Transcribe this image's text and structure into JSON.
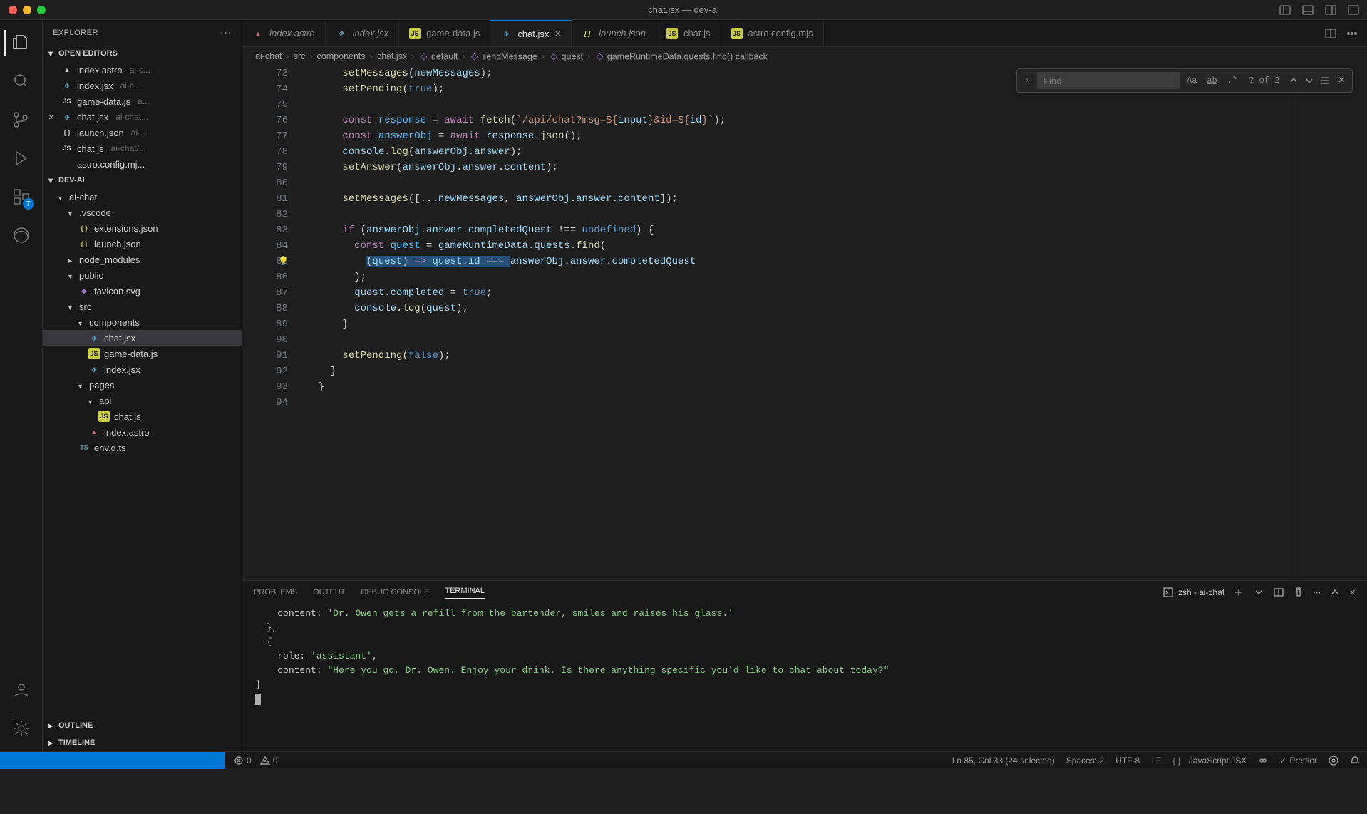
{
  "title": "chat.jsx — dev-ai",
  "explorer": {
    "title": "EXPLORER",
    "openEditorsLabel": "OPEN EDITORS",
    "workspaceLabel": "DEV-AI",
    "outlineLabel": "OUTLINE",
    "timelineLabel": "TIMELINE",
    "openEditors": [
      {
        "name": "index.astro",
        "hint": "ai-c..."
      },
      {
        "name": "index.jsx",
        "hint": "ai-c..."
      },
      {
        "name": "game-data.js",
        "hint": "a..."
      },
      {
        "name": "chat.jsx",
        "hint": "ai-chat...",
        "active": true
      },
      {
        "name": "launch.json",
        "hint": "ai-..."
      },
      {
        "name": "chat.js",
        "hint": "ai-chat/..."
      },
      {
        "name": "astro.config.mj...",
        "hint": ""
      }
    ],
    "tree": [
      {
        "label": "ai-chat",
        "depth": 1,
        "folder": true,
        "open": true
      },
      {
        "label": ".vscode",
        "depth": 2,
        "folder": true,
        "open": true
      },
      {
        "label": "extensions.json",
        "depth": 3,
        "icon": "json"
      },
      {
        "label": "launch.json",
        "depth": 3,
        "icon": "json"
      },
      {
        "label": "node_modules",
        "depth": 2,
        "folder": true
      },
      {
        "label": "public",
        "depth": 2,
        "folder": true,
        "open": true
      },
      {
        "label": "favicon.svg",
        "depth": 3,
        "icon": "svg"
      },
      {
        "label": "src",
        "depth": 2,
        "folder": true,
        "open": true
      },
      {
        "label": "components",
        "depth": 3,
        "folder": true,
        "open": true
      },
      {
        "label": "chat.jsx",
        "depth": 4,
        "icon": "jsx",
        "selected": true
      },
      {
        "label": "game-data.js",
        "depth": 4,
        "icon": "js"
      },
      {
        "label": "index.jsx",
        "depth": 4,
        "icon": "jsx"
      },
      {
        "label": "pages",
        "depth": 3,
        "folder": true,
        "open": true
      },
      {
        "label": "api",
        "depth": 4,
        "folder": true,
        "open": true
      },
      {
        "label": "chat.js",
        "depth": 5,
        "icon": "js"
      },
      {
        "label": "index.astro",
        "depth": 4,
        "icon": "astro"
      },
      {
        "label": "env.d.ts",
        "depth": 3,
        "icon": "ts"
      }
    ]
  },
  "tabs": [
    {
      "label": "index.astro",
      "icon": "astro",
      "italic": true
    },
    {
      "label": "index.jsx",
      "icon": "jsx",
      "italic": true
    },
    {
      "label": "game-data.js",
      "icon": "js"
    },
    {
      "label": "chat.jsx",
      "icon": "jsx",
      "active": true,
      "close": true
    },
    {
      "label": "launch.json",
      "icon": "json",
      "italic": true
    },
    {
      "label": "chat.js",
      "icon": "js"
    },
    {
      "label": "astro.config.mjs",
      "icon": "js"
    }
  ],
  "breadcrumbs": [
    "ai-chat",
    "src",
    "components",
    "chat.jsx",
    "default",
    "sendMessage",
    "quest",
    "gameRuntimeData.quests.find() callback"
  ],
  "find": {
    "placeholder": "Find",
    "count": "? of 2"
  },
  "code": {
    "start": 73,
    "lines": [
      {
        "n": 73,
        "html": "      <span class='c-fn'>setMessages</span>(<span class='c-var'>newMessages</span>);"
      },
      {
        "n": 74,
        "html": "      <span class='c-fn'>setPending</span>(<span class='c-bool'>true</span>);"
      },
      {
        "n": 75,
        "html": ""
      },
      {
        "n": 76,
        "html": "      <span class='c-kw'>const</span> <span class='c-const'>response</span> = <span class='c-kw'>await</span> <span class='c-fn'>fetch</span>(<span class='c-str'>`/api/chat?msg=${</span><span class='c-var'>input</span><span class='c-str'>}&amp;id=${</span><span class='c-var'>id</span><span class='c-str'>}`</span>);"
      },
      {
        "n": 77,
        "html": "      <span class='c-kw'>const</span> <span class='c-const'>answerObj</span> = <span class='c-kw'>await</span> <span class='c-var'>response</span>.<span class='c-fn'>json</span>();"
      },
      {
        "n": 78,
        "html": "      <span class='c-var'>console</span>.<span class='c-fn'>log</span>(<span class='c-var'>answerObj</span>.<span class='c-var'>answer</span>);"
      },
      {
        "n": 79,
        "html": "      <span class='c-fn'>setAnswer</span>(<span class='c-var'>answerObj</span>.<span class='c-var'>answer</span>.<span class='c-var'>content</span>);"
      },
      {
        "n": 80,
        "html": ""
      },
      {
        "n": 81,
        "html": "      <span class='c-fn'>setMessages</span>([...<span class='c-var'>newMessages</span>, <span class='c-var'>answerObj</span>.<span class='c-var'>answer</span>.<span class='c-var'>content</span>]);"
      },
      {
        "n": 82,
        "html": ""
      },
      {
        "n": 83,
        "html": "      <span class='c-kw'>if</span> (<span class='c-var'>answerObj</span>.<span class='c-var'>answer</span>.<span class='c-var'>completedQuest</span> !== <span class='c-bool'>undefined</span>) {"
      },
      {
        "n": 84,
        "html": "        <span class='c-kw'>const</span> <span class='c-const'>quest</span> = <span class='c-var'>gameRuntimeData</span>.<span class='c-var'>quests</span>.<span class='c-fn'>find</span>("
      },
      {
        "n": 85,
        "html": "          <span class='sel'>(<span class='c-var'>quest</span>) <span class='c-kw'>=&gt;</span> <span class='c-var'>quest</span>.<span class='c-var'>id</span> === </span><span class='c-var'>answerObj</span>.<span class='c-var'>answer</span>.<span class='c-var'>completedQuest</span>",
        "bulb": true
      },
      {
        "n": 86,
        "html": "        );"
      },
      {
        "n": 87,
        "html": "        <span class='c-var'>quest</span>.<span class='c-var'>completed</span> = <span class='c-bool'>true</span>;"
      },
      {
        "n": 88,
        "html": "        <span class='c-var'>console</span>.<span class='c-fn'>log</span>(<span class='c-var'>quest</span>);"
      },
      {
        "n": 89,
        "html": "      }"
      },
      {
        "n": 90,
        "html": ""
      },
      {
        "n": 91,
        "html": "      <span class='c-fn'>setPending</span>(<span class='c-bool'>false</span>);"
      },
      {
        "n": 92,
        "html": "    }"
      },
      {
        "n": 93,
        "html": "  }"
      },
      {
        "n": 94,
        "html": ""
      }
    ]
  },
  "panel": {
    "tabs": [
      "PROBLEMS",
      "OUTPUT",
      "DEBUG CONSOLE",
      "TERMINAL"
    ],
    "active": "TERMINAL",
    "shell": "zsh - ai-chat",
    "lines": [
      {
        "html": "    content: <span class='t-str'>'Dr. Owen gets a refill from the bartender, smiles and raises his glass.'</span>"
      },
      {
        "html": "  },"
      },
      {
        "html": "  {"
      },
      {
        "html": "    role: <span class='t-str'>'assistant'</span>,"
      },
      {
        "html": "    content: <span class='t-str'>\"Here you go, Dr. Owen. Enjoy your drink. Is there anything specific you'd like to chat about today?\"</span>"
      },
      {
        "html": "]"
      },
      {
        "html": "<span class='cursor-block'></span>"
      }
    ]
  },
  "status": {
    "errors": "0",
    "warnings": "0",
    "cursor": "Ln 85, Col 33 (24 selected)",
    "spaces": "Spaces: 2",
    "encoding": "UTF-8",
    "eol": "LF",
    "lang": "JavaScript JSX",
    "prettier": "Prettier"
  },
  "activity": {
    "extBadge": "7"
  }
}
